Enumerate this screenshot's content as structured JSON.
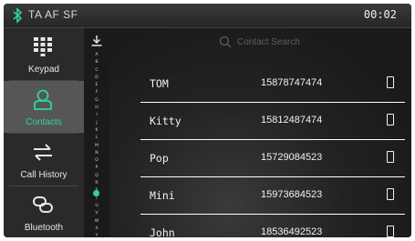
{
  "header": {
    "status_text": "TA AF SF",
    "clock": "00:02"
  },
  "sidebar": {
    "items": [
      {
        "label": "Keypad"
      },
      {
        "label": "Contacts"
      },
      {
        "label": "Call History"
      },
      {
        "label": "Bluetooth"
      }
    ]
  },
  "alpha_index": {
    "letters": [
      "A",
      "B",
      "C",
      "D",
      "E",
      "F",
      "G",
      "H",
      "I",
      "J",
      "K",
      "L",
      "M",
      "N",
      "O",
      "P",
      "Q",
      "R",
      "S",
      "T",
      "U",
      "V",
      "W",
      "X",
      "Y",
      "Z"
    ]
  },
  "search": {
    "placeholder": "Contact Search"
  },
  "contacts": [
    {
      "name": "TOM",
      "number": "15878747474"
    },
    {
      "name": "Kitty",
      "number": "15812487474"
    },
    {
      "name": "Pop",
      "number": "15729084523"
    },
    {
      "name": "Mini",
      "number": "15973684523"
    },
    {
      "name": "John",
      "number": "18536492523"
    }
  ],
  "colors": {
    "accent": "#2fd59a",
    "background": "#1a1a1a",
    "sidebar": "#2a2a2a",
    "active_item": "#565656"
  }
}
